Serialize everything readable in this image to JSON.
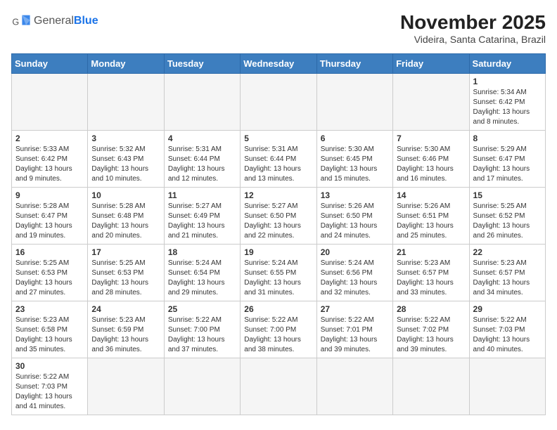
{
  "header": {
    "logo_general": "General",
    "logo_blue": "Blue",
    "month_title": "November 2025",
    "location": "Videira, Santa Catarina, Brazil"
  },
  "weekdays": [
    "Sunday",
    "Monday",
    "Tuesday",
    "Wednesday",
    "Thursday",
    "Friday",
    "Saturday"
  ],
  "weeks": [
    [
      {
        "day": "",
        "info": ""
      },
      {
        "day": "",
        "info": ""
      },
      {
        "day": "",
        "info": ""
      },
      {
        "day": "",
        "info": ""
      },
      {
        "day": "",
        "info": ""
      },
      {
        "day": "",
        "info": ""
      },
      {
        "day": "1",
        "info": "Sunrise: 5:34 AM\nSunset: 6:42 PM\nDaylight: 13 hours and 8 minutes."
      }
    ],
    [
      {
        "day": "2",
        "info": "Sunrise: 5:33 AM\nSunset: 6:42 PM\nDaylight: 13 hours and 9 minutes."
      },
      {
        "day": "3",
        "info": "Sunrise: 5:32 AM\nSunset: 6:43 PM\nDaylight: 13 hours and 10 minutes."
      },
      {
        "day": "4",
        "info": "Sunrise: 5:31 AM\nSunset: 6:44 PM\nDaylight: 13 hours and 12 minutes."
      },
      {
        "day": "5",
        "info": "Sunrise: 5:31 AM\nSunset: 6:44 PM\nDaylight: 13 hours and 13 minutes."
      },
      {
        "day": "6",
        "info": "Sunrise: 5:30 AM\nSunset: 6:45 PM\nDaylight: 13 hours and 15 minutes."
      },
      {
        "day": "7",
        "info": "Sunrise: 5:30 AM\nSunset: 6:46 PM\nDaylight: 13 hours and 16 minutes."
      },
      {
        "day": "8",
        "info": "Sunrise: 5:29 AM\nSunset: 6:47 PM\nDaylight: 13 hours and 17 minutes."
      }
    ],
    [
      {
        "day": "9",
        "info": "Sunrise: 5:28 AM\nSunset: 6:47 PM\nDaylight: 13 hours and 19 minutes."
      },
      {
        "day": "10",
        "info": "Sunrise: 5:28 AM\nSunset: 6:48 PM\nDaylight: 13 hours and 20 minutes."
      },
      {
        "day": "11",
        "info": "Sunrise: 5:27 AM\nSunset: 6:49 PM\nDaylight: 13 hours and 21 minutes."
      },
      {
        "day": "12",
        "info": "Sunrise: 5:27 AM\nSunset: 6:50 PM\nDaylight: 13 hours and 22 minutes."
      },
      {
        "day": "13",
        "info": "Sunrise: 5:26 AM\nSunset: 6:50 PM\nDaylight: 13 hours and 24 minutes."
      },
      {
        "day": "14",
        "info": "Sunrise: 5:26 AM\nSunset: 6:51 PM\nDaylight: 13 hours and 25 minutes."
      },
      {
        "day": "15",
        "info": "Sunrise: 5:25 AM\nSunset: 6:52 PM\nDaylight: 13 hours and 26 minutes."
      }
    ],
    [
      {
        "day": "16",
        "info": "Sunrise: 5:25 AM\nSunset: 6:53 PM\nDaylight: 13 hours and 27 minutes."
      },
      {
        "day": "17",
        "info": "Sunrise: 5:25 AM\nSunset: 6:53 PM\nDaylight: 13 hours and 28 minutes."
      },
      {
        "day": "18",
        "info": "Sunrise: 5:24 AM\nSunset: 6:54 PM\nDaylight: 13 hours and 29 minutes."
      },
      {
        "day": "19",
        "info": "Sunrise: 5:24 AM\nSunset: 6:55 PM\nDaylight: 13 hours and 31 minutes."
      },
      {
        "day": "20",
        "info": "Sunrise: 5:24 AM\nSunset: 6:56 PM\nDaylight: 13 hours and 32 minutes."
      },
      {
        "day": "21",
        "info": "Sunrise: 5:23 AM\nSunset: 6:57 PM\nDaylight: 13 hours and 33 minutes."
      },
      {
        "day": "22",
        "info": "Sunrise: 5:23 AM\nSunset: 6:57 PM\nDaylight: 13 hours and 34 minutes."
      }
    ],
    [
      {
        "day": "23",
        "info": "Sunrise: 5:23 AM\nSunset: 6:58 PM\nDaylight: 13 hours and 35 minutes."
      },
      {
        "day": "24",
        "info": "Sunrise: 5:23 AM\nSunset: 6:59 PM\nDaylight: 13 hours and 36 minutes."
      },
      {
        "day": "25",
        "info": "Sunrise: 5:22 AM\nSunset: 7:00 PM\nDaylight: 13 hours and 37 minutes."
      },
      {
        "day": "26",
        "info": "Sunrise: 5:22 AM\nSunset: 7:00 PM\nDaylight: 13 hours and 38 minutes."
      },
      {
        "day": "27",
        "info": "Sunrise: 5:22 AM\nSunset: 7:01 PM\nDaylight: 13 hours and 39 minutes."
      },
      {
        "day": "28",
        "info": "Sunrise: 5:22 AM\nSunset: 7:02 PM\nDaylight: 13 hours and 39 minutes."
      },
      {
        "day": "29",
        "info": "Sunrise: 5:22 AM\nSunset: 7:03 PM\nDaylight: 13 hours and 40 minutes."
      }
    ],
    [
      {
        "day": "30",
        "info": "Sunrise: 5:22 AM\nSunset: 7:03 PM\nDaylight: 13 hours and 41 minutes."
      },
      {
        "day": "",
        "info": ""
      },
      {
        "day": "",
        "info": ""
      },
      {
        "day": "",
        "info": ""
      },
      {
        "day": "",
        "info": ""
      },
      {
        "day": "",
        "info": ""
      },
      {
        "day": "",
        "info": ""
      }
    ]
  ]
}
